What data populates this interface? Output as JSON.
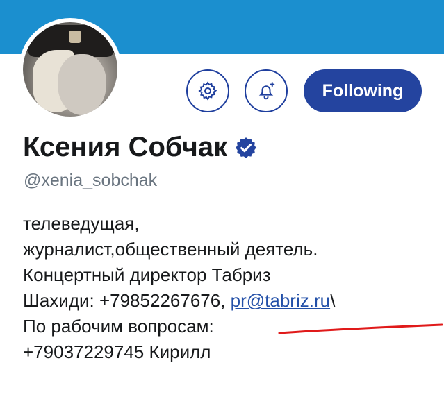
{
  "profile": {
    "name": "Ксения Собчак",
    "handle": "@xenia_sobchak",
    "follow_label": "Following",
    "bio": {
      "line1": "телеведущая,",
      "line2": "журналист,общественный деятель.",
      "line3": "Концертный директор Табриз",
      "line4_prefix": "Шахиди: +79852267676, ",
      "line4_link": "pr@tabriz.ru",
      "line4_suffix": "\\",
      "line5": "По рабочим вопросам:",
      "line6": "+79037229745 Кирилл"
    }
  },
  "icons": {
    "settings": "gear-icon",
    "notifications": "bell-plus-icon",
    "verified": "verified-badge-icon"
  },
  "colors": {
    "banner": "#1b8fcf",
    "accent": "#24449f",
    "link": "#2350a8",
    "annotation": "#e01a1a"
  }
}
